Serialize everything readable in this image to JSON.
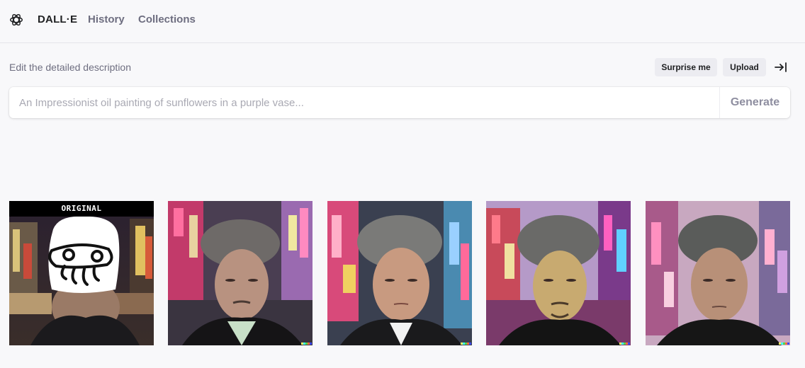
{
  "nav": {
    "brand": "DALL·E",
    "history": "History",
    "collections": "Collections"
  },
  "editor": {
    "label": "Edit the detailed description",
    "surprise": "Surprise me",
    "upload": "Upload",
    "placeholder": "An Impressionist oil painting of sunflowers in a purple vase...",
    "value": "",
    "generate": "Generate"
  },
  "results": {
    "original_label": "ORIGINAL"
  },
  "colors": {
    "accent_muted": "#6e6e80",
    "pill_bg": "#ececf1",
    "page_bg": "#f8f8fa"
  },
  "icons": {
    "logo": "openai-logo-icon",
    "collapse": "arrow-right-to-line-icon"
  }
}
